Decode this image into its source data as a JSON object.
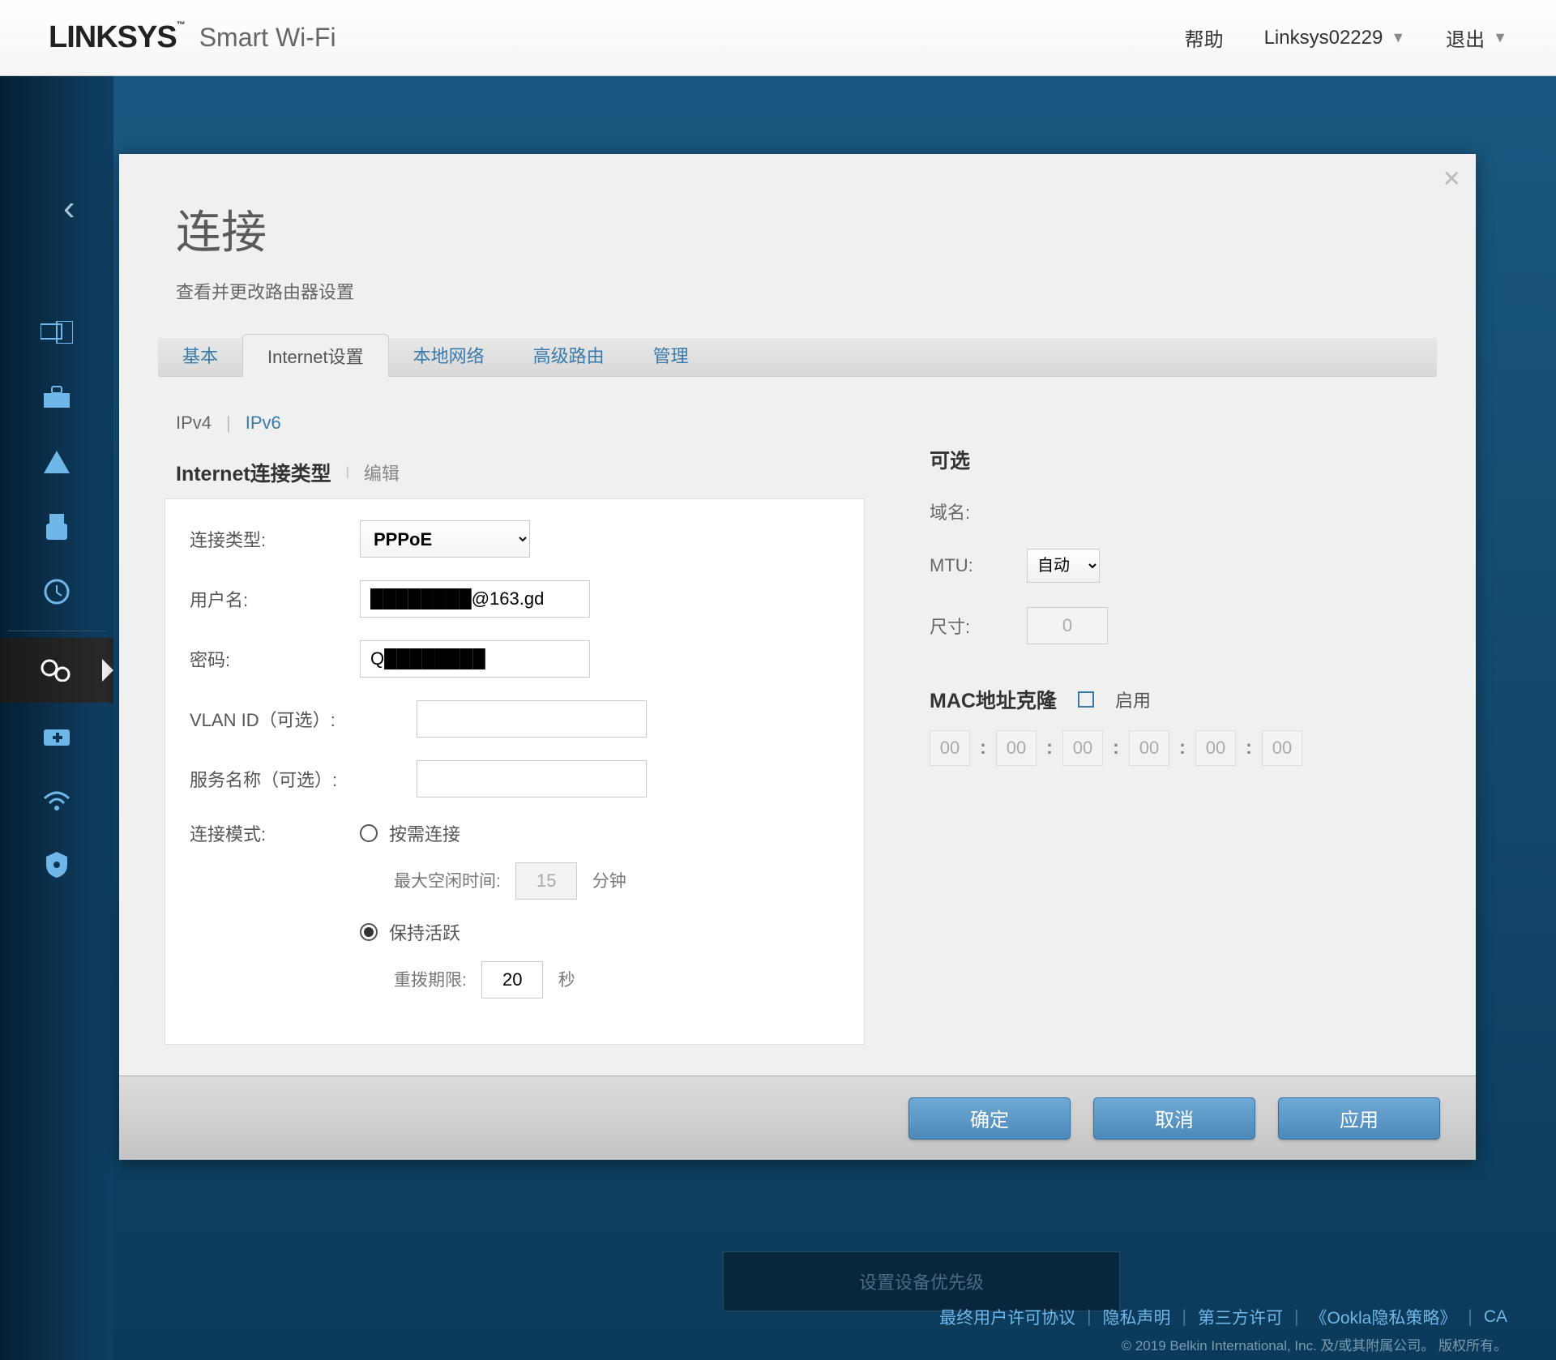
{
  "header": {
    "brand": "LINKSYS",
    "brandSuffix": "Smart Wi-Fi",
    "help": "帮助",
    "account": "Linksys02229",
    "logout": "退出"
  },
  "page": {
    "title": "连接",
    "subtitle": "查看并更改路由器设置"
  },
  "tabs": {
    "basic": "基本",
    "internet": "Internet设置",
    "localNet": "本地网络",
    "advRouting": "高级路由",
    "admin": "管理"
  },
  "subtabs": {
    "ipv4": "IPv4",
    "ipv6": "IPv6"
  },
  "section": {
    "title": "Internet连接类型",
    "edit": "编辑"
  },
  "form": {
    "connTypeLabel": "连接类型:",
    "connTypeValue": "PPPoE",
    "userLabel": "用户名:",
    "userValue": "████████@163.gd",
    "passLabel": "密码:",
    "passValue": "Q████████",
    "vlanLabel": "VLAN ID（可选）:",
    "vlanValue": "",
    "serviceLabel": "服务名称（可选）:",
    "serviceValue": "",
    "connModeLabel": "连接模式:",
    "onDemand": "按需连接",
    "maxIdleLabel": "最大空闲时间:",
    "maxIdleValue": "15",
    "minutes": "分钟",
    "keepAlive": "保持活跃",
    "redialLabel": "重拨期限:",
    "redialValue": "20",
    "seconds": "秒"
  },
  "optional": {
    "title": "可选",
    "domainLabel": "域名:",
    "domainValue": "",
    "mtuLabel": "MTU:",
    "mtuValue": "自动",
    "sizeLabel": "尺寸:",
    "sizeValue": "0",
    "macTitle": "MAC地址克隆",
    "enable": "启用",
    "macParts": [
      "00",
      "00",
      "00",
      "00",
      "00",
      "00"
    ]
  },
  "buttons": {
    "ok": "确定",
    "cancel": "取消",
    "apply": "应用"
  },
  "underBox": "设置设备优先级",
  "footer": {
    "eula": "最终用户许可协议",
    "privacy": "隐私声明",
    "thirdParty": "第三方许可",
    "ookla": "《Ookla隐私策略》",
    "ca": "CA",
    "copy": "© 2019 Belkin International, Inc. 及/或其附属公司。 版权所有。"
  }
}
